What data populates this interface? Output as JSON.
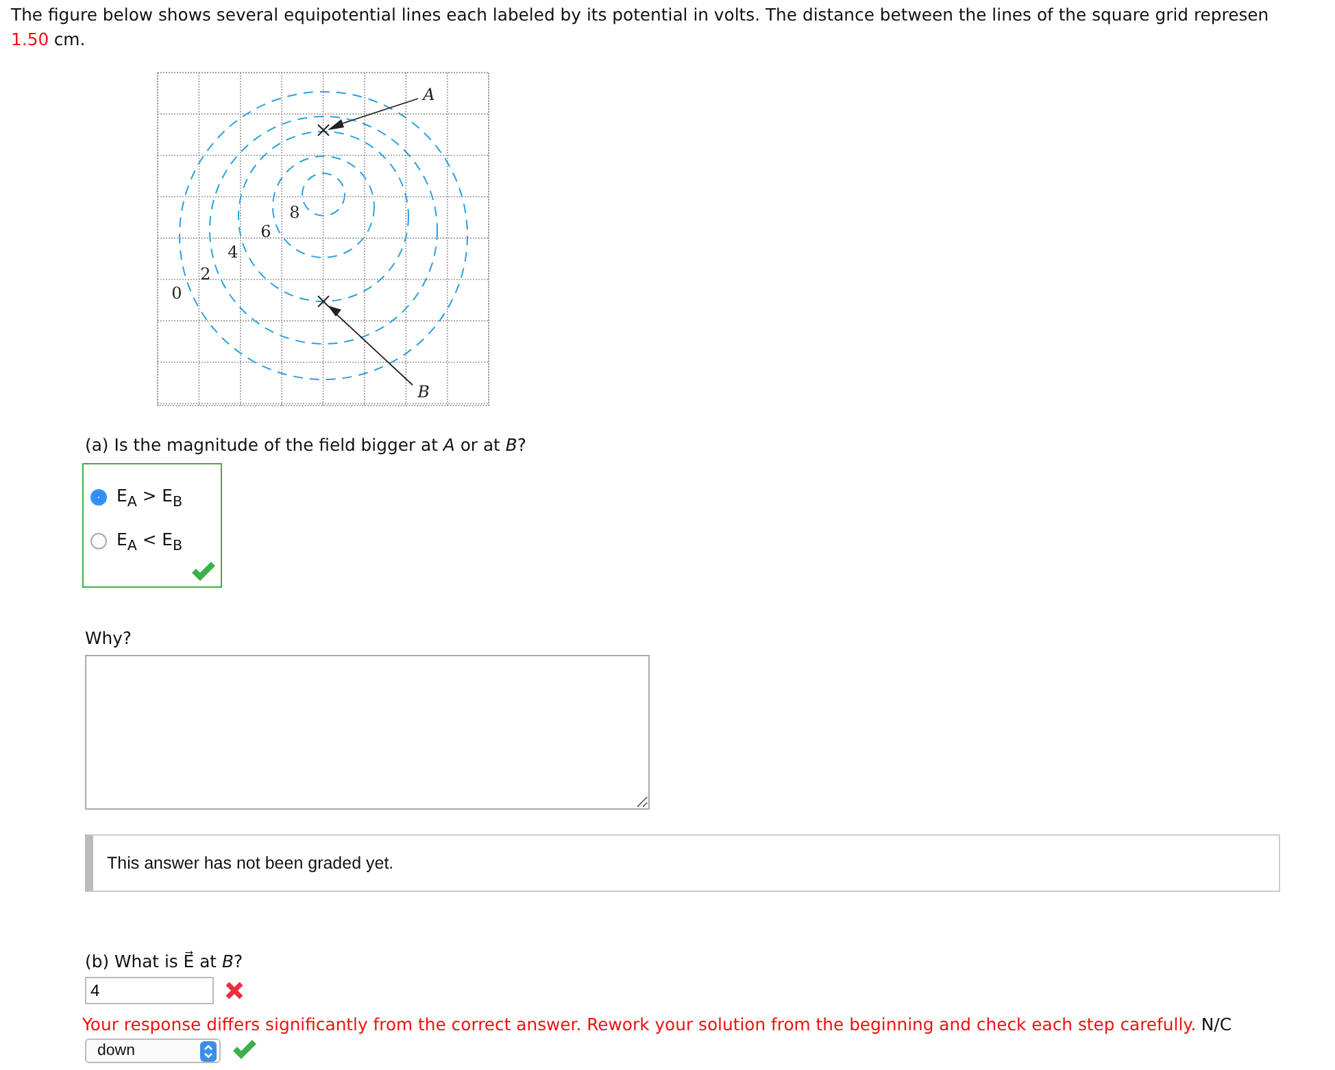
{
  "intro": {
    "text": "The figure below shows several equipotential lines each labeled by its potential in volts. The distance between the lines of the square grid represen",
    "value": "1.50",
    "unit": "cm."
  },
  "figure": {
    "point_labels": [
      "A",
      "B"
    ],
    "line_labels": [
      "8",
      "6",
      "4",
      "2",
      "0"
    ]
  },
  "part_a": {
    "question": "(a) Is the magnitude of the field bigger at *A* or at *B*?",
    "correct": true,
    "options": [
      {
        "label": "E$_{A}$ > E$_{B}$",
        "selected": true
      },
      {
        "label": "E$_{A}$ < E$_{B}$",
        "selected": false
      }
    ]
  },
  "why": {
    "label": "Why?",
    "note": "This answer has not been graded yet."
  },
  "part_b": {
    "question": "(b) What is E⃗ at *B*?",
    "value": "4",
    "correct": false,
    "feedback": "Your response differs significantly from the correct answer. Rework your solution from the beginning and check each step carefully.",
    "unit": "N/C",
    "direction": "down",
    "direction_correct": true
  }
}
